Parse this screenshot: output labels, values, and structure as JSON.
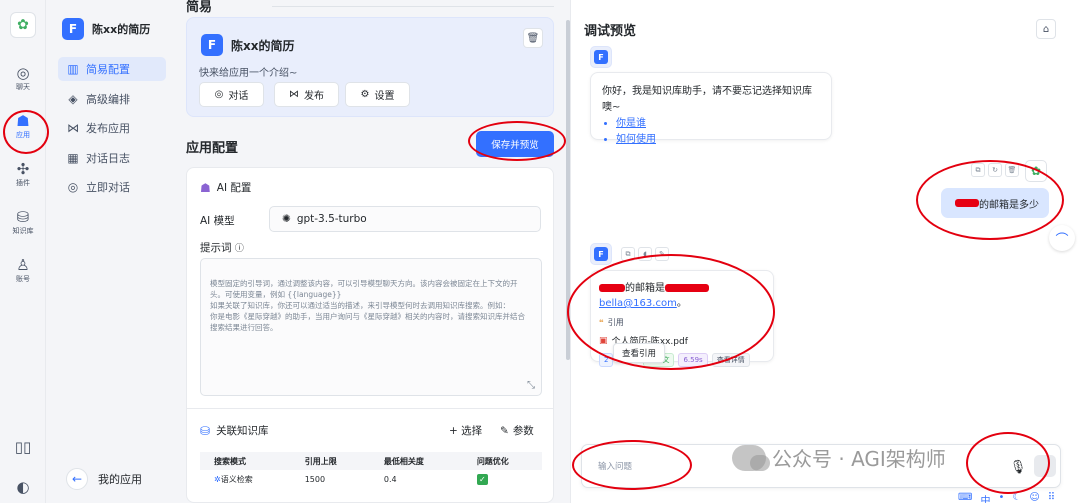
{
  "rail": {
    "items": [
      {
        "label": "聊天",
        "icon": "chat-icon"
      },
      {
        "label": "应用",
        "icon": "robot-icon"
      },
      {
        "label": "插件",
        "icon": "puzzle-icon"
      },
      {
        "label": "知识库",
        "icon": "database-icon"
      },
      {
        "label": "账号",
        "icon": "user-icon"
      }
    ]
  },
  "nav": {
    "title": "陈xx的简历",
    "items": [
      {
        "label": "简易配置"
      },
      {
        "label": "高级编排"
      },
      {
        "label": "发布应用"
      },
      {
        "label": "对话日志"
      },
      {
        "label": "立即对话"
      }
    ],
    "back_label": "我的应用"
  },
  "editor": {
    "top_cut": "简易",
    "app_card": {
      "name": "陈xx的简历",
      "intro": "快来给应用一个介绍~",
      "buttons": [
        "对话",
        "发布",
        "设置"
      ]
    },
    "section_title": "应用配置",
    "save_button": "保存并预览",
    "ai_config": {
      "title": "AI 配置",
      "model_label": "AI 模型",
      "model_value": "gpt-3.5-turbo",
      "prompt_label": "提示词",
      "prompt_placeholder": "模型固定的引导词，通过调整该内容，可以引导模型聊天方向。该内容会被固定在上下文的开头。可使用变量，例如 {{language}}\n如果关联了知识库，你还可以通过适当的描述，来引导模型何时去调用知识库搜索。例如：\n你是电影《星际穿越》的助手，当用户询问与《星际穿越》相关的内容时，请搜索知识库并结合搜索结果进行回答。"
    },
    "kb": {
      "title": "关联知识库",
      "select_label": "+ 选择",
      "params_label": "参数",
      "columns": [
        "搜索模式",
        "引用上限",
        "最低相关度",
        "问题优化"
      ],
      "row": {
        "mode": "语义检索",
        "limit": "1500",
        "similarity": "0.4",
        "optimize": "✓"
      }
    }
  },
  "preview": {
    "title": "调试预览",
    "welcome_text": "你好，我是知识库助手，请不要忘记选择知识库噢~",
    "welcome_links": [
      "你是谁",
      "如何使用"
    ],
    "user_message": "的邮箱是多少",
    "answer": {
      "prefix": "的邮箱是",
      "email": "bella@163.com",
      "suffix": "。",
      "cite_label": "引用",
      "file": "个人简历-陈xx.pdf",
      "tags": [
        "2",
        "上下文",
        "6.59s",
        "查看详情"
      ],
      "tooltip": "查看引用"
    },
    "input_placeholder": "输入问题"
  },
  "watermark": "公众号 · AGI架构师",
  "colors": {
    "accent": "#3370ff",
    "annotation": "#e3000f",
    "check": "#32a852"
  }
}
